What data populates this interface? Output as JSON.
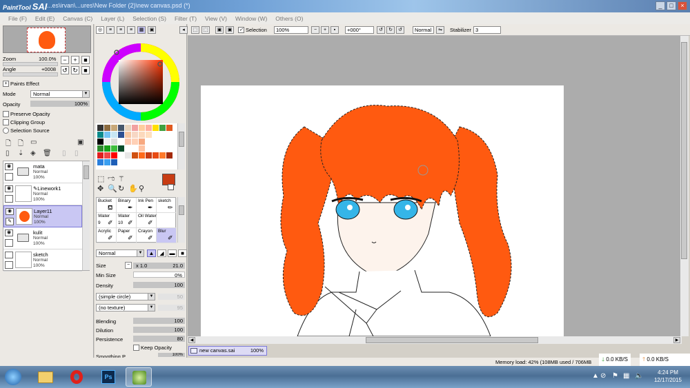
{
  "app": {
    "logo_text": "PaintTool",
    "logo_big": "SAI",
    "title_path": "...es\\irvan\\...ures\\New Folder (2)\\new canvas.psd (*)",
    "window_buttons": [
      "_",
      "□",
      "×"
    ]
  },
  "menu": [
    "File (F)",
    "Edit (E)",
    "Canvas (C)",
    "Layer (L)",
    "Selection (S)",
    "Filter (T)",
    "View (V)",
    "Window (W)",
    "Others (O)"
  ],
  "navigator": {
    "zoom_label": "Zoom",
    "zoom_value": "100.0%",
    "angle_label": "Angle",
    "angle_value": "+0008"
  },
  "layer_props": {
    "paints_effect": "Paints Effect",
    "mode_label": "Mode",
    "mode_value": "Normal",
    "opacity_label": "Opacity",
    "opacity_value": "100%",
    "preserve_opacity": "Preserve Opacity",
    "clipping_group": "Clipping Group",
    "selection_source": "Selection Source"
  },
  "layers": [
    {
      "name": "mata",
      "mode": "Normal",
      "opacity": "100%",
      "type": "folder",
      "selected": false
    },
    {
      "name": "Linework1",
      "mode": "Normal",
      "opacity": "100%",
      "type": "linework",
      "selected": false
    },
    {
      "name": "Layer11",
      "mode": "Normal",
      "opacity": "100%",
      "type": "layer",
      "selected": true
    },
    {
      "name": "kulit",
      "mode": "Normal",
      "opacity": "100%",
      "type": "folder",
      "selected": false
    },
    {
      "name": "sketch",
      "mode": "Normal",
      "opacity": "100%",
      "type": "layer",
      "selected": false
    }
  ],
  "colors": {
    "primary": "#c83c13",
    "secondary": "#ffffff",
    "hair": "#ff5a10",
    "selected_bg": "#c9c7f3"
  },
  "brushes": [
    {
      "name": "Bucket",
      "size": "",
      "icon": "bucket-icon"
    },
    {
      "name": "Binary",
      "size": "",
      "icon": "pen-icon"
    },
    {
      "name": "Ink Pen",
      "size": "",
      "icon": "pen-icon"
    },
    {
      "name": "sketch",
      "size": "",
      "icon": "pencil-icon"
    },
    {
      "name": "Water",
      "size": "9",
      "icon": "brush-icon"
    },
    {
      "name": "Water",
      "size": "10",
      "icon": "brush-icon"
    },
    {
      "name": "Oil Water",
      "size": "",
      "icon": "brush-icon"
    },
    {
      "name": "",
      "size": "",
      "icon": ""
    },
    {
      "name": "Acrylic",
      "size": "",
      "icon": "brush-icon"
    },
    {
      "name": "Paper",
      "size": "",
      "icon": "brush-icon"
    },
    {
      "name": "Crayon",
      "size": "",
      "icon": "brush-icon"
    },
    {
      "name": "Blur",
      "size": "",
      "icon": "brush-icon",
      "selected": true
    }
  ],
  "brush_settings": {
    "blend_mode": "Normal",
    "size_label": "Size",
    "size_mult": "x 1.0",
    "size_value": "21.0",
    "min_size_label": "Min Size",
    "min_size_value": "0%",
    "density_label": "Density",
    "density_value": "100",
    "shape": "(simple circle)",
    "shape_value": "50",
    "texture": "(no texture)",
    "texture_value": "95",
    "blending_label": "Blending",
    "blending_value": "100",
    "dilution_label": "Dilution",
    "dilution_value": "100",
    "persistence_label": "Persistence",
    "persistence_value": "80",
    "keep_opacity": "Keep Opacity",
    "smoothing_label": "Smoothing P.",
    "smoothing_value": "100%"
  },
  "canvas_toolbar": {
    "selection_label": "Selection",
    "zoom": "100%",
    "rotation": "+000°",
    "mode": "Normal",
    "stabilizer_label": "Stabilizer",
    "stabilizer_value": "3"
  },
  "document_tab": {
    "name": "new canvas.sai",
    "percent": "100%"
  },
  "status": {
    "memory": "Memory load: 42% (108MB used / 706MB",
    "down_speed": "0.0 KB/S",
    "up_speed": "0.0 KB/S"
  },
  "clock": {
    "time": "4:24 PM",
    "date": "12/17/2015"
  },
  "taskbar_apps": [
    "start-orb",
    "explorer-icon",
    "opera-icon",
    "photoshop-icon",
    "paint-tool-sai-icon"
  ]
}
